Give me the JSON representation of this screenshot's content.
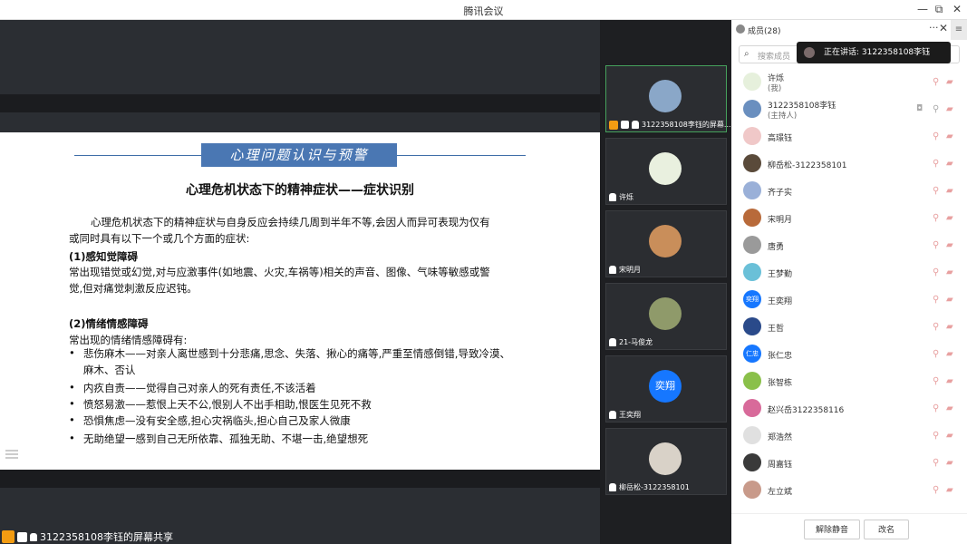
{
  "window": {
    "title": "腾讯会议",
    "min": "—",
    "restore": "⧉",
    "close": "✕"
  },
  "slide": {
    "banner": "心理问题认识与预警",
    "title": "心理危机状态下的精神症状——症状识别",
    "intro_1": "心理危机状态下的精神症状与自身反应会持续几周到半年不等,会因人而异可表现为仅有",
    "intro_2": "或同时具有以下一个或几个方面的症状:",
    "h1": "(1)感知觉障碍",
    "p1_1": "常出现错觉或幻觉,对与应激事件(如地震、火灾,车祸等)相关的声音、图像、气味等敏感或警",
    "p1_2": "觉,但对痛觉刺激反应迟钝。",
    "h2": "(2)情绪情感障碍",
    "p2": "常出现的情绪情感障碍有:",
    "bullets": [
      "悲伤麻木——对亲人离世感到十分悲痛,思念、失落、揪心的痛等,严重至情感倒错,导致冷漠、",
      "麻木、否认",
      "内疚自责——觉得自己对亲人的死有责任,不该活着",
      "愤怒易激——惹恨上天不公,恨别人不出手相助,恨医生见死不救",
      "恐惧焦虑—没有安全感,担心灾祸临头,担心自己及家人微康",
      "无助绝望一感到自己无所依靠、孤独无助、不堪一击,绝望想死"
    ],
    "bullet_mark": "•"
  },
  "share_bar": {
    "label": "3122358108李钰的屏幕共享"
  },
  "video_tiles": [
    {
      "caption": "3122358108李钰的屏幕...",
      "avatar_color": "#8aa7c8"
    },
    {
      "caption": "许烁",
      "avatar_color": "#e9f0df"
    },
    {
      "caption": "宋明月",
      "avatar_color": "#c98e5a"
    },
    {
      "caption": "21-马俊龙",
      "avatar_color": "#8f9a6a"
    },
    {
      "caption": "王奕翔",
      "avatar_color": "#1677ff",
      "avatar_text": "奕翔"
    },
    {
      "caption": "柳岳松-3122358101",
      "avatar_color": "#d9d2c8"
    }
  ],
  "panel": {
    "title": "成员(28)",
    "dots": "···",
    "close": "✕",
    "menu": "≡",
    "search_placeholder": "搜索成员",
    "speaking": "正在讲话: 3122358108李钰",
    "members": [
      {
        "name": "许烁",
        "sub": "(我)",
        "color": "#e6f0dc"
      },
      {
        "name": "3122358108李钰",
        "sub": "(主持人)",
        "color": "#6a8fbf"
      },
      {
        "name": "高璟钰",
        "color": "#f0c8c8"
      },
      {
        "name": "柳岳松-3122358101",
        "color": "#5a4a3a"
      },
      {
        "name": "齐子实",
        "color": "#9ab0d8"
      },
      {
        "name": "宋明月",
        "color": "#b86a3a"
      },
      {
        "name": "唐勇",
        "color": "#9a9a9a"
      },
      {
        "name": "王梦勤",
        "color": "#6ac0d8"
      },
      {
        "name": "王奕翔",
        "color": "#1677ff",
        "initials": "奕翔"
      },
      {
        "name": "王哲",
        "color": "#2a4a8a"
      },
      {
        "name": "张仁忠",
        "color": "#1677ff",
        "initials": "仁忠"
      },
      {
        "name": "张智栋",
        "color": "#8ac04a"
      },
      {
        "name": "赵兴岳3122358116",
        "color": "#d86a9a"
      },
      {
        "name": "郑浩然",
        "color": "#e0e0e0"
      },
      {
        "name": "周嘉钰",
        "color": "#3a3a3a"
      },
      {
        "name": "左立斌",
        "color": "#c89a8a"
      }
    ],
    "mute_all": "解除静音",
    "rename": "改名"
  },
  "colors": {
    "accent": "#4a77b3",
    "active_border": "#46a15c",
    "host_orange": "#f39c12"
  }
}
